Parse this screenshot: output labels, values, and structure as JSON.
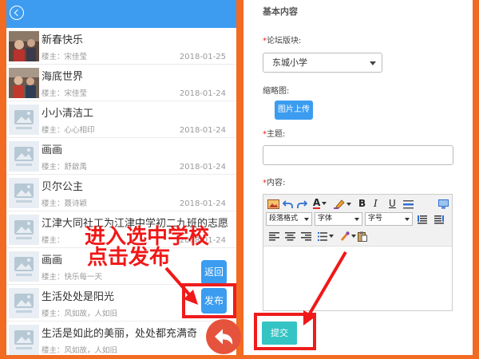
{
  "left": {
    "header": {
      "back_icon": "back-circle-icon",
      "color": "#3d9cf0"
    },
    "posts": [
      {
        "title": "新春快乐",
        "author": "楼主：宋佳莹",
        "date": "2018-01-25",
        "thumb_icon": "photo-thumbnail-icon"
      },
      {
        "title": "海底世界",
        "author": "楼主：宋佳莹",
        "date": "2018-01-24",
        "thumb_icon": "photo-thumbnail-icon"
      },
      {
        "title": "小小清洁工",
        "author": "楼主：心心相印",
        "date": "2018-01-24",
        "thumb_icon": "image-placeholder-icon"
      },
      {
        "title": "画画",
        "author": "楼主：舒啟禹",
        "date": "2018-01-24",
        "thumb_icon": "image-placeholder-icon"
      },
      {
        "title": "贝尔公主",
        "author": "楼主：聂诗颖",
        "date": "2018-01-24",
        "thumb_icon": "image-placeholder-icon"
      },
      {
        "title": "江津大同社工为江津中学初二九班的志愿",
        "author": "楼主：",
        "date": "2018-01-24",
        "thumb_icon": "image-placeholder-icon"
      },
      {
        "title": "画画",
        "author": "楼主：快乐每一天",
        "thumb_icon": "image-placeholder-icon"
      },
      {
        "title": "生活处处是阳光",
        "author": "楼主：风如故，人如旧",
        "thumb_icon": "image-placeholder-icon"
      },
      {
        "title": "生活是如此的美丽，处处都充满奇",
        "author": "楼主：风如故，人如旧",
        "thumb_icon": "image-placeholder-icon"
      }
    ],
    "float_buttons": {
      "back_label": "返回",
      "publish_label": "发布",
      "return_icon": "reply-arrow-icon"
    }
  },
  "annotations": {
    "line1": "进入选中学校",
    "line2": "点击发布"
  },
  "right": {
    "section_title": "基本内容",
    "required_mark": "*",
    "forum_label": "论坛版块:",
    "forum_value": "东城小学",
    "thumbnail_label": "缩略图:",
    "upload_button": "图片上传",
    "subject_label": "主题:",
    "content_label": "内容:",
    "editor": {
      "font_color_glyph": "A",
      "bold_glyph": "B",
      "italic_glyph": "I",
      "underline_glyph": "U",
      "paragraph_select": "段落格式",
      "font_select": "字体",
      "size_select": "字号",
      "toolbar_icons": [
        "insert-image-icon",
        "undo-icon",
        "redo-icon",
        "font-color-icon",
        "highlight-icon",
        "bold-icon",
        "italic-icon",
        "underline-icon",
        "horizontal-rule-icon",
        "preview-icon",
        "justify-icon",
        "align-full-icon",
        "align-left-icon",
        "align-center-icon",
        "align-right-icon",
        "list-icon",
        "brush-icon",
        "paste-icon"
      ]
    },
    "submit_button": "提交"
  },
  "colors": {
    "frame_orange": "#f26b22",
    "header_blue": "#3d9cf0",
    "button_blue": "#3b9cf0",
    "submit_teal": "#35c4c4",
    "annotation_red": "#f01818",
    "fab_red": "#e5533d"
  }
}
